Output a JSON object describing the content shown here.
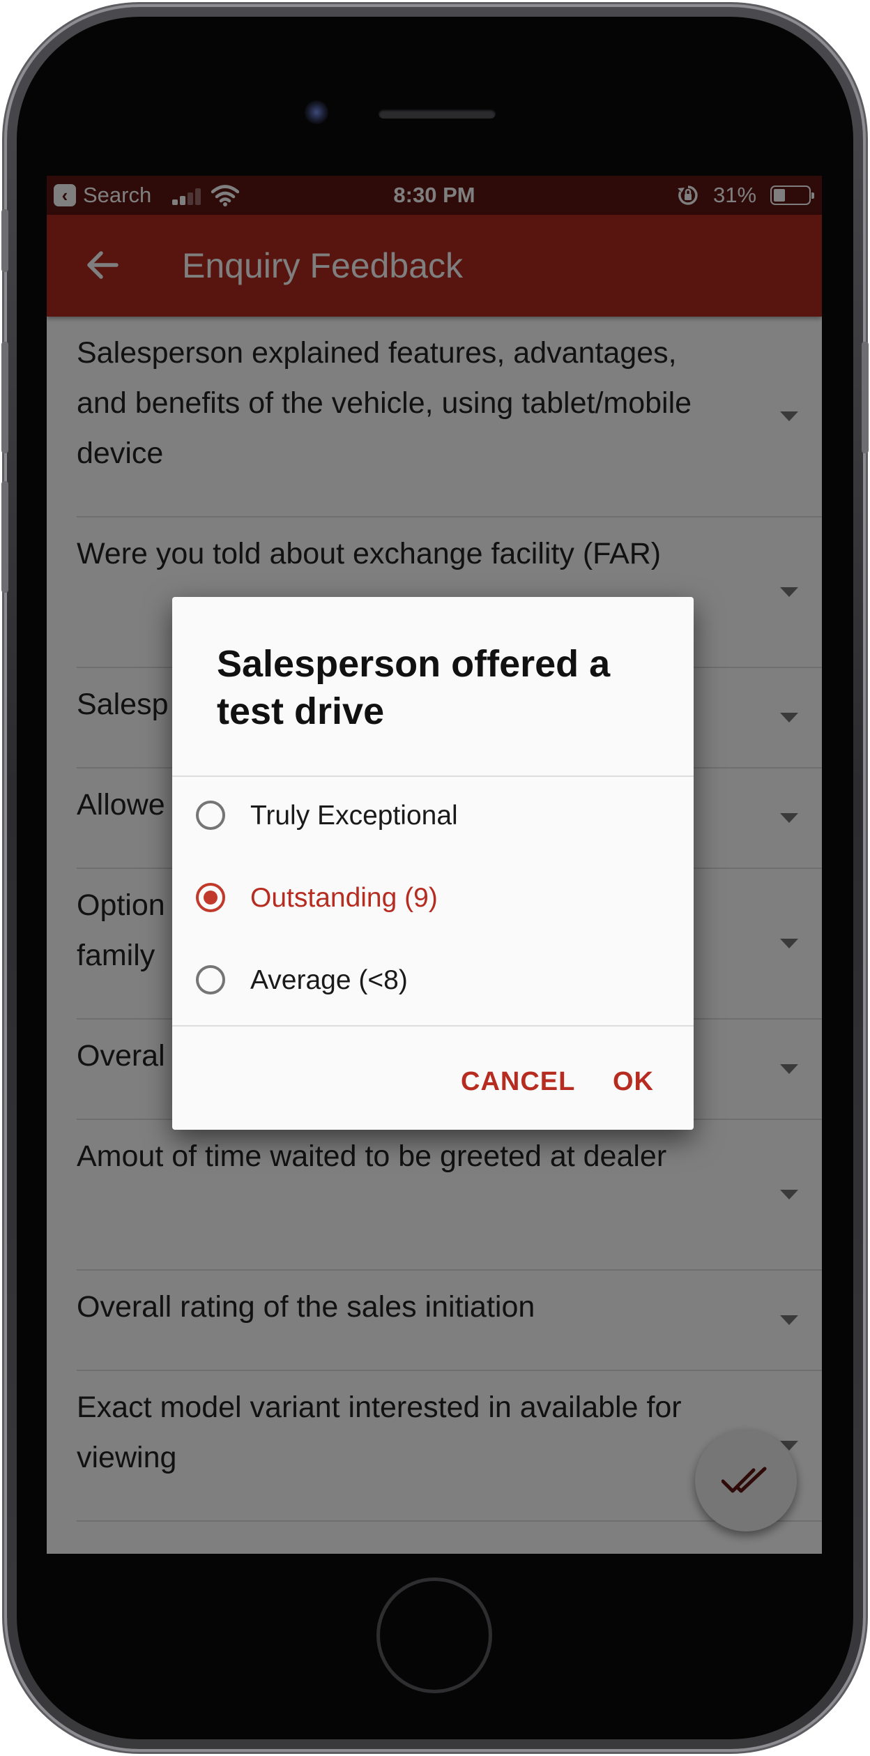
{
  "status_bar": {
    "back_app_label": "Search",
    "time": "8:30 PM",
    "battery_percent": "31%"
  },
  "app_bar": {
    "title": "Enquiry Feedback"
  },
  "questions": [
    "Salesperson explained features, advantages, and benefits of the vehicle, using tablet/mobile device",
    "Were you told about exchange facility (FAR)",
    "Salesp",
    "Allowe",
    "Option family",
    "Overal",
    "Amout of time waited to be greeted at dealer",
    "Overall rating of the sales initiation",
    "Exact model variant interested in available for viewing"
  ],
  "dialog": {
    "title": "Salesperson offered a test drive",
    "options": [
      {
        "label": "Truly Exceptional",
        "selected": false
      },
      {
        "label": "Outstanding (9)",
        "selected": true
      },
      {
        "label": "Average (<8)",
        "selected": false
      }
    ],
    "cancel_label": "CANCEL",
    "ok_label": "OK"
  },
  "colors": {
    "status_bar": "#5d1410",
    "app_bar": "#b02a1e",
    "accent": "#b72c20"
  },
  "icons": {
    "back": "arrow-left-icon",
    "fab": "double-check-icon"
  }
}
